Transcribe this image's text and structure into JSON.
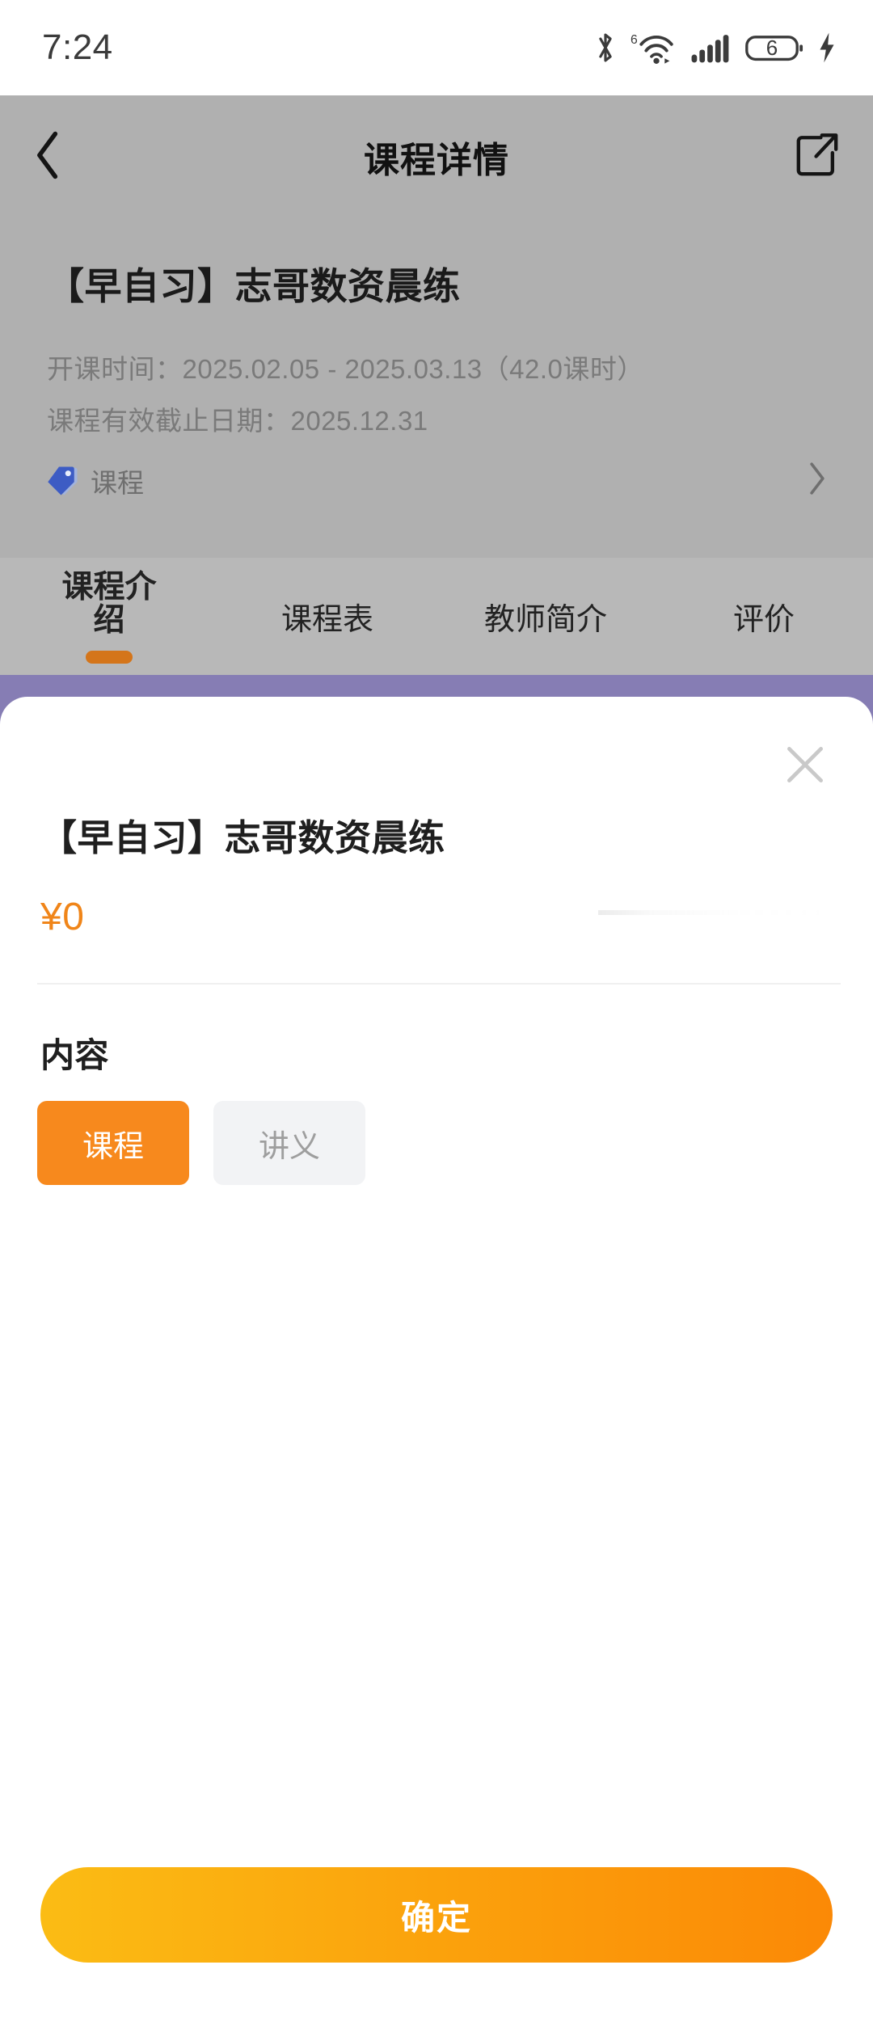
{
  "status_bar": {
    "time": "7:24",
    "icons": [
      "bluetooth-icon",
      "wifi-6-icon",
      "cellular-signal-icon",
      "battery-icon",
      "charging-bolt-icon"
    ],
    "battery_level": "6"
  },
  "header": {
    "title": "课程详情",
    "back_icon": "chevron-left-icon",
    "share_icon": "external-link-icon",
    "background": "#b0b0b0"
  },
  "course": {
    "title": "【早自习】志哥数资晨练",
    "start_line": "开课时间：2025.02.05 - 2025.03.13（42.0课时）",
    "expiry_line": "课程有效截止日期：2025.12.31",
    "tag_icon": "tag-icon",
    "tag_label": "课程",
    "tag_chevron": "chevron-right-icon"
  },
  "tabs": {
    "items": [
      {
        "label": "课程介绍",
        "active": true
      },
      {
        "label": "课程表",
        "active": false
      },
      {
        "label": "教师简介",
        "active": false
      },
      {
        "label": "评价",
        "active": false
      }
    ],
    "active_underline_color": "#d4751a"
  },
  "overlay": {
    "color": "#867db4"
  },
  "sheet": {
    "close_icon": "close-icon",
    "title": "【早自习】志哥数资晨练",
    "price": "¥0",
    "price_color": "#f08519",
    "price_ghost_text": "",
    "section_title": "内容",
    "chips": [
      {
        "label": "课程",
        "selected": true
      },
      {
        "label": "讲义",
        "selected": false
      }
    ],
    "chip_selected_color": "#f7891d",
    "chip_unselected_color": "#f2f3f5",
    "confirm_label": "确定",
    "confirm_gradient_from": "#fbbc14",
    "confirm_gradient_to": "#fb8906"
  }
}
